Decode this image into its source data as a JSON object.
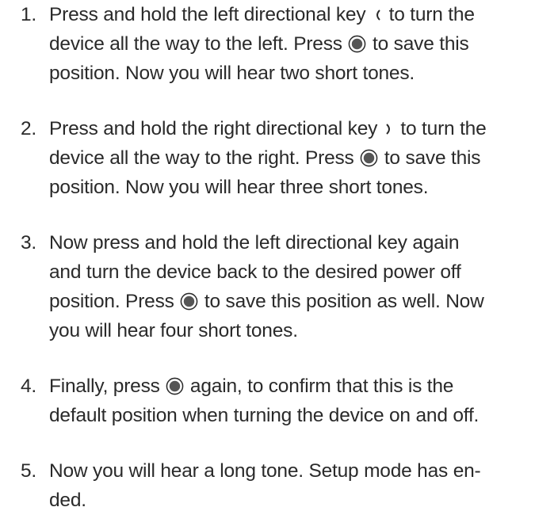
{
  "steps": [
    {
      "number": "1.",
      "lines": [
        {
          "a": "Press and hold the left directional key",
          "icon": "left-arrow-icon",
          "b": "to turn the"
        },
        {
          "a": "device all the way to the left. Press",
          "icon": "select-button-icon",
          "b": "to save this"
        },
        {
          "a": "position. Now you will hear two short tones."
        }
      ]
    },
    {
      "number": "2.",
      "lines": [
        {
          "a": "Press and hold the right directional key",
          "icon": "right-arrow-icon",
          "b": "to turn the"
        },
        {
          "a": "device all the way to the right. Press",
          "icon": "select-button-icon",
          "b": "to save this"
        },
        {
          "a": "position. Now you will hear three short tones."
        }
      ]
    },
    {
      "number": "3.",
      "lines": [
        {
          "a": "Now press and hold the left directional key again"
        },
        {
          "a": "and turn the device back to the desired power off"
        },
        {
          "a": "position. Press",
          "icon": "select-button-icon",
          "b": "to save this position as well. Now"
        },
        {
          "a": "you will hear four short tones."
        }
      ]
    },
    {
      "number": "4.",
      "lines": [
        {
          "a": "Finally, press",
          "icon": "select-button-icon",
          "b": "again, to confirm that this is the"
        },
        {
          "a": "default position when turning the device on and off."
        }
      ]
    },
    {
      "number": "5.",
      "lines": [
        {
          "a": "Now you will hear a long tone. Setup mode has en-"
        },
        {
          "a": "ded."
        }
      ]
    }
  ]
}
